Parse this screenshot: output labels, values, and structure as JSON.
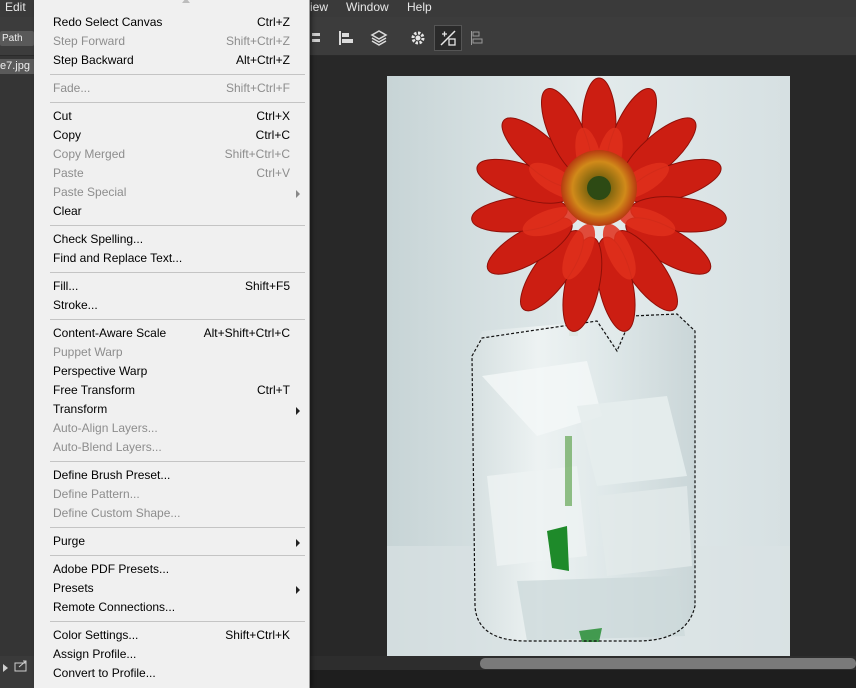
{
  "menubar": {
    "items": [
      "Edit",
      "iew",
      "Window",
      "Help"
    ]
  },
  "options_bar": {
    "path_button": "Path"
  },
  "document": {
    "tab_label": "e7.jpg"
  },
  "edit_menu": {
    "groups": [
      [
        {
          "label": "Redo Select Canvas",
          "shortcut": "Ctrl+Z",
          "enabled": true
        },
        {
          "label": "Step Forward",
          "shortcut": "Shift+Ctrl+Z",
          "enabled": false
        },
        {
          "label": "Step Backward",
          "shortcut": "Alt+Ctrl+Z",
          "enabled": true
        }
      ],
      [
        {
          "label": "Fade...",
          "shortcut": "Shift+Ctrl+F",
          "enabled": false
        }
      ],
      [
        {
          "label": "Cut",
          "shortcut": "Ctrl+X",
          "enabled": true
        },
        {
          "label": "Copy",
          "shortcut": "Ctrl+C",
          "enabled": true
        },
        {
          "label": "Copy Merged",
          "shortcut": "Shift+Ctrl+C",
          "enabled": false
        },
        {
          "label": "Paste",
          "shortcut": "Ctrl+V",
          "enabled": false
        },
        {
          "label": "Paste Special",
          "shortcut": "",
          "enabled": false,
          "submenu": true
        },
        {
          "label": "Clear",
          "shortcut": "",
          "enabled": true
        }
      ],
      [
        {
          "label": "Check Spelling...",
          "shortcut": "",
          "enabled": true
        },
        {
          "label": "Find and Replace Text...",
          "shortcut": "",
          "enabled": true
        }
      ],
      [
        {
          "label": "Fill...",
          "shortcut": "Shift+F5",
          "enabled": true
        },
        {
          "label": "Stroke...",
          "shortcut": "",
          "enabled": true
        }
      ],
      [
        {
          "label": "Content-Aware Scale",
          "shortcut": "Alt+Shift+Ctrl+C",
          "enabled": true
        },
        {
          "label": "Puppet Warp",
          "shortcut": "",
          "enabled": false
        },
        {
          "label": "Perspective Warp",
          "shortcut": "",
          "enabled": true
        },
        {
          "label": "Free Transform",
          "shortcut": "Ctrl+T",
          "enabled": true
        },
        {
          "label": "Transform",
          "shortcut": "",
          "enabled": true,
          "submenu": true
        },
        {
          "label": "Auto-Align Layers...",
          "shortcut": "",
          "enabled": false
        },
        {
          "label": "Auto-Blend Layers...",
          "shortcut": "",
          "enabled": false
        }
      ],
      [
        {
          "label": "Define Brush Preset...",
          "shortcut": "",
          "enabled": true
        },
        {
          "label": "Define Pattern...",
          "shortcut": "",
          "enabled": false
        },
        {
          "label": "Define Custom Shape...",
          "shortcut": "",
          "enabled": false
        }
      ],
      [
        {
          "label": "Purge",
          "shortcut": "",
          "enabled": true,
          "submenu": true
        }
      ],
      [
        {
          "label": "Adobe PDF Presets...",
          "shortcut": "",
          "enabled": true
        },
        {
          "label": "Presets",
          "shortcut": "",
          "enabled": true,
          "submenu": true
        },
        {
          "label": "Remote Connections...",
          "shortcut": "",
          "enabled": true
        }
      ],
      [
        {
          "label": "Color Settings...",
          "shortcut": "Shift+Ctrl+K",
          "enabled": true
        },
        {
          "label": "Assign Profile...",
          "shortcut": "",
          "enabled": true
        },
        {
          "label": "Convert to Profile...",
          "shortcut": "",
          "enabled": true
        }
      ]
    ]
  },
  "toolbar_icons": [
    "align-distribute-icon",
    "align-left-icon",
    "3d-stack-icon",
    "gear-icon",
    "auto-transform-icon",
    "distribute-icon"
  ],
  "colors": {
    "menu_bg": "#f0f0f0",
    "disabled_text": "#8d8d8d",
    "app_bg": "#282828",
    "flower_red": "#cc1e12"
  }
}
